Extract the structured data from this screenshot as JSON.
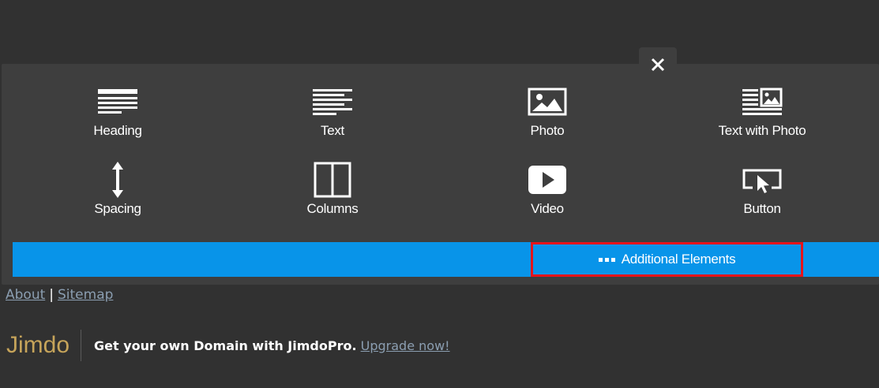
{
  "panel": {
    "close_icon": "close-icon",
    "elements": [
      {
        "label": "Heading",
        "icon": "heading-icon"
      },
      {
        "label": "Text",
        "icon": "text-icon"
      },
      {
        "label": "Photo",
        "icon": "photo-icon"
      },
      {
        "label": "Text with Photo",
        "icon": "text-with-photo-icon"
      },
      {
        "label": "Spacing",
        "icon": "spacing-icon"
      },
      {
        "label": "Columns",
        "icon": "columns-icon"
      },
      {
        "label": "Video",
        "icon": "video-icon"
      },
      {
        "label": "Button",
        "icon": "button-icon"
      }
    ],
    "additional_label": "Additional Elements"
  },
  "footer": {
    "about": "About",
    "separator": "|",
    "sitemap": "Sitemap"
  },
  "jimdo": {
    "logo_text": "Jimdo",
    "promo_text": "Get your own Domain with JimdoPro.",
    "upgrade_link": "Upgrade now!"
  },
  "colors": {
    "background": "#313131",
    "panel": "#3e3e3e",
    "bar": "#0894e9",
    "highlight_border": "#e5141b",
    "link": "#8b9eb1",
    "logo": "#c6a45a"
  }
}
